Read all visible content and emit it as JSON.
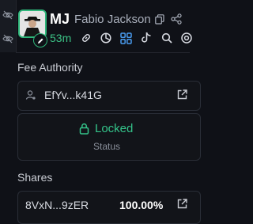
{
  "token": {
    "symbol": "MJ",
    "name": "Fabio Jackson",
    "age": "53m"
  },
  "fee_authority": {
    "heading": "Fee Authority",
    "address": "EfYv...k41G"
  },
  "status": {
    "value": "Locked",
    "label": "Status"
  },
  "shares": {
    "heading": "Shares",
    "rows": [
      {
        "address": "8VxN...9zER",
        "percent": "100.00%"
      }
    ]
  },
  "colors": {
    "accent": "#2fb67a",
    "background": "#0f1117",
    "text_muted": "#8a909b"
  },
  "icons": [
    "eye-off-icon",
    "copy-icon",
    "share-icon",
    "link-icon",
    "pie-chart-icon",
    "grid-icon",
    "tiktok-icon",
    "search-icon",
    "at-icon",
    "user-icon",
    "external-link-icon",
    "lock-icon",
    "pencil-icon"
  ]
}
